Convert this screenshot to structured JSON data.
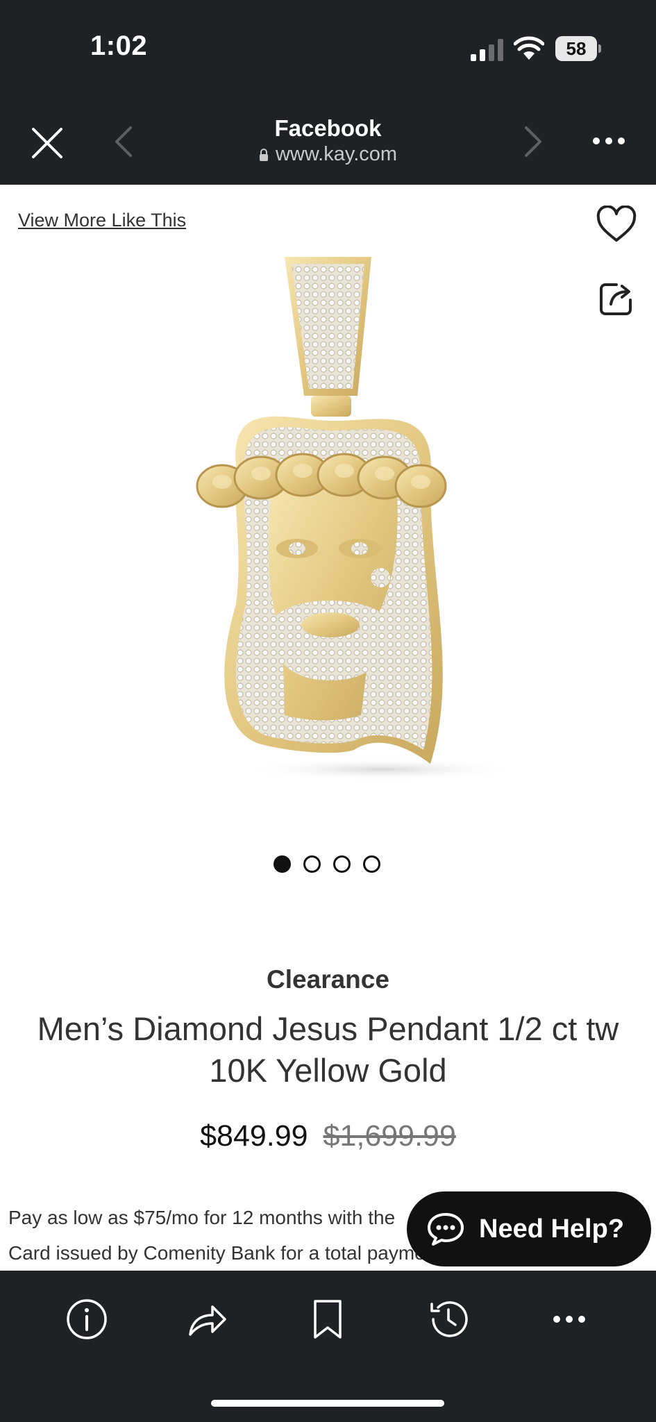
{
  "status_bar": {
    "time": "1:02",
    "battery": "58"
  },
  "browser": {
    "title": "Facebook",
    "url": "www.kay.com"
  },
  "page": {
    "view_more_link": "View More Like This",
    "carousel": {
      "count": 4,
      "active_index": 0
    },
    "badge": "Clearance",
    "product_title": "Men’s Diamond Jesus Pendant 1/2 ct tw 10K Yellow Gold",
    "price_current": "$849.99",
    "price_original": "$1,699.99",
    "finance_line1": "Pay as low as $75/mo for 12 months with the",
    "finance_line2": "Card issued by Comenity Bank for a total payment of $849.99."
  },
  "help_button": {
    "label": "Need Help?"
  },
  "toolbar": {
    "items": [
      "info-icon",
      "share-icon",
      "bookmark-icon",
      "history-icon",
      "more-icon"
    ]
  },
  "colors": {
    "chrome_bg": "#202124",
    "gold": "#E3C882",
    "text": "#333333"
  }
}
